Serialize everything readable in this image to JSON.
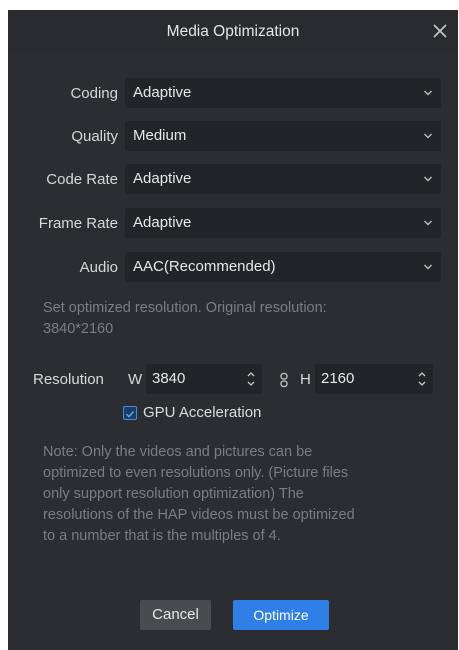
{
  "dialog": {
    "title": "Media Optimization"
  },
  "form": {
    "coding": {
      "label": "Coding",
      "value": "Adaptive"
    },
    "quality": {
      "label": "Quality",
      "value": "Medium"
    },
    "code_rate": {
      "label": "Code Rate",
      "value": "Adaptive"
    },
    "frame_rate": {
      "label": "Frame Rate",
      "value": "Adaptive"
    },
    "audio": {
      "label": "Audio",
      "value": "AAC(Recommended)"
    }
  },
  "resolution": {
    "hint_line1": "Set optimized resolution. Original resolution:",
    "hint_line2": "3840*2160",
    "label": "Resolution",
    "w_label": "W",
    "w_value": "3840",
    "h_label": "H",
    "h_value": "2160"
  },
  "gpu": {
    "label": "GPU Acceleration",
    "checked": true
  },
  "note": {
    "line1": "Note: Only the videos and pictures can be",
    "line2": "optimized to even resolutions only. (Picture files",
    "line3": "only support resolution optimization) The",
    "line4": "resolutions of the HAP videos must be optimized",
    "line5": "to a number that is the multiples of 4."
  },
  "buttons": {
    "cancel": "Cancel",
    "optimize": "Optimize"
  },
  "colors": {
    "dialog_bg": "#2c2d30",
    "field_bg": "#232427",
    "accent": "#2f7fe6"
  },
  "icons": {
    "close": "close-icon",
    "dropdown": "chevron-down-icon",
    "spinner": "spinner-arrows-icon",
    "link": "chain-link-icon",
    "check": "checkbox-checked-icon"
  }
}
